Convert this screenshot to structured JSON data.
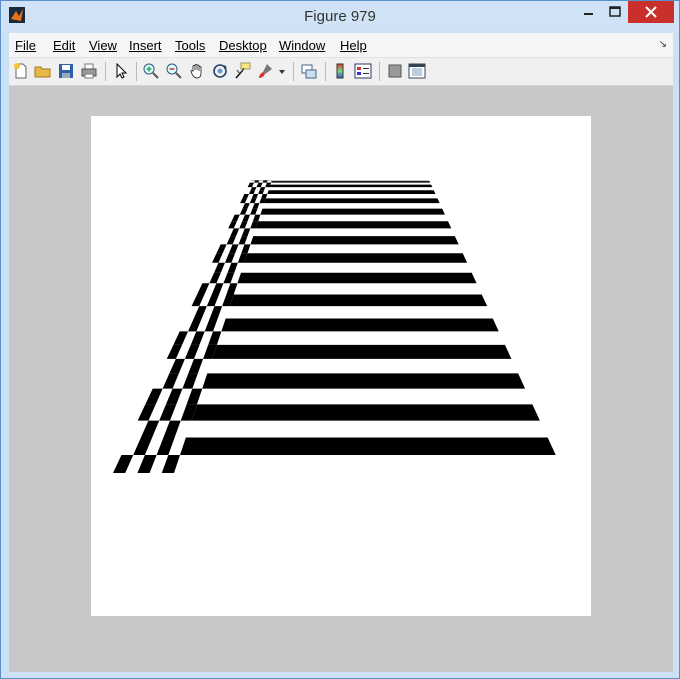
{
  "window": {
    "title": "Figure 979"
  },
  "menu": [
    {
      "label": "File"
    },
    {
      "label": "Edit"
    },
    {
      "label": "View"
    },
    {
      "label": "Insert"
    },
    {
      "label": "Tools"
    },
    {
      "label": "Desktop"
    },
    {
      "label": "Window"
    },
    {
      "label": "Help"
    }
  ],
  "toolbar": {
    "icons": [
      "new-figure-icon",
      "open-file-icon",
      "save-icon",
      "print-icon",
      "pointer-icon",
      "zoom-in-icon",
      "zoom-out-icon",
      "pan-hand-icon",
      "rotate-3d-icon",
      "data-cursor-icon",
      "brush-icon",
      "link-plot-icon",
      "colorbar-icon",
      "legend-icon",
      "hide-plot-tools-icon",
      "show-plot-tools-icon"
    ]
  },
  "colors": {
    "titlebar": "#cfe2f6",
    "close": "#c9302c",
    "figure_bg": "#c8c8c8",
    "axes_bg": "#ffffff",
    "pattern": "#000000"
  }
}
